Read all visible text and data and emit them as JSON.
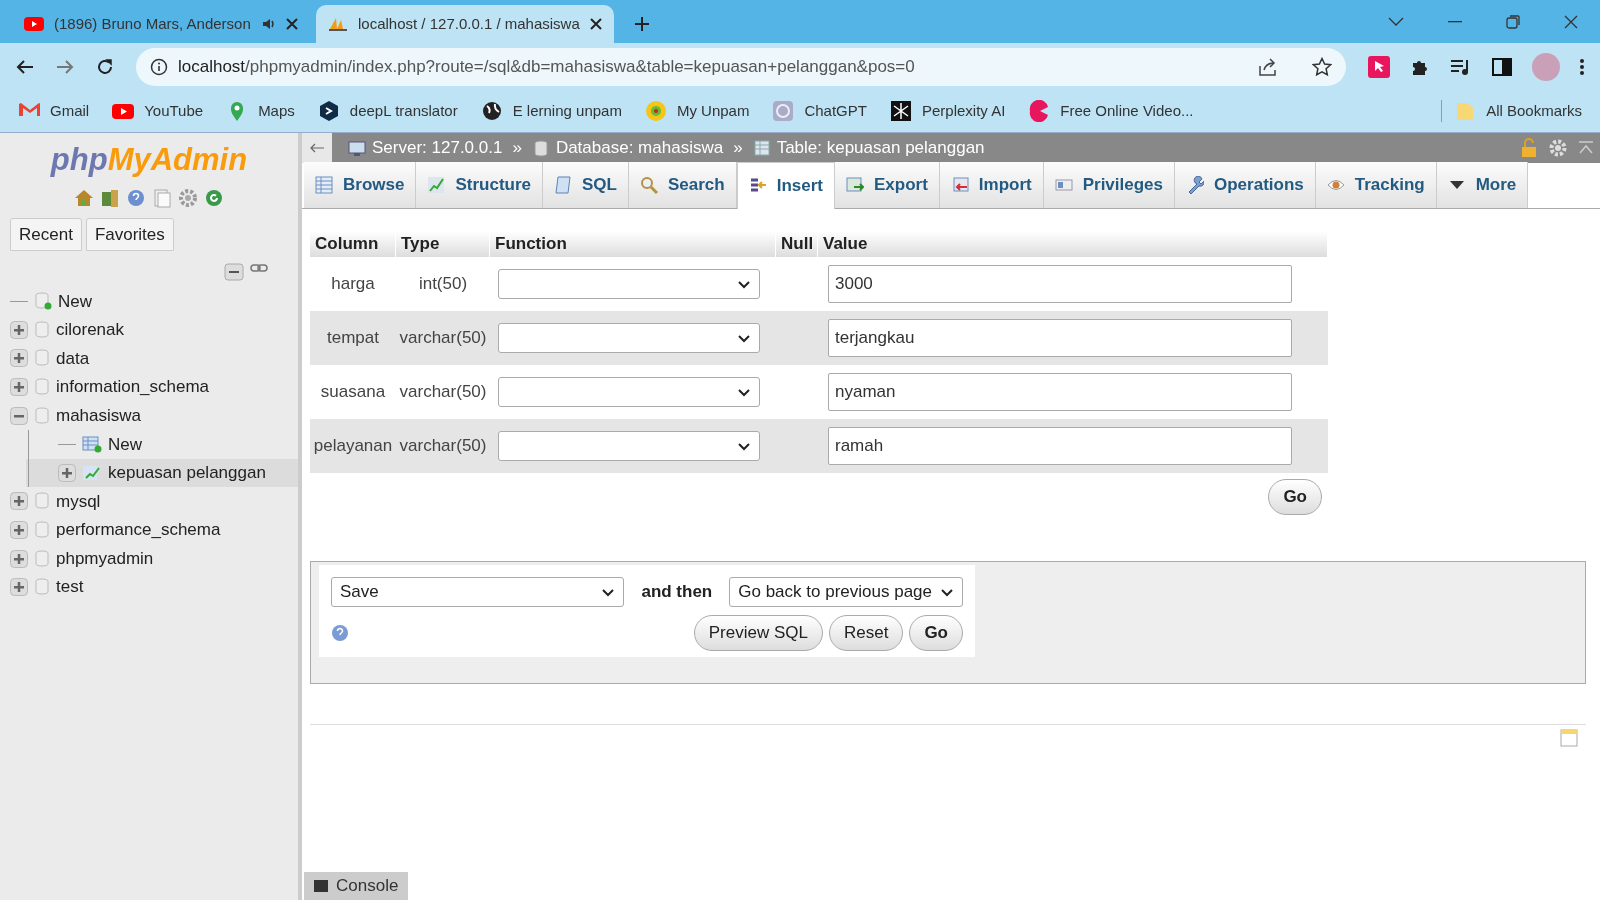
{
  "browser": {
    "tabs": [
      {
        "kind": "video",
        "title": "(1896) Bruno Mars, Anderson",
        "audio": true,
        "selected": false
      },
      {
        "kind": "pma",
        "title": "localhost / 127.0.0.1 / mahasiswa",
        "audio": false,
        "selected": true
      }
    ],
    "address": {
      "host": "localhost",
      "path": "/phpmyadmin/index.php?route=/sql&db=mahasiswa&table=kepuasan+pelanggan&pos=0"
    },
    "bookmarks": [
      {
        "label": "Gmail"
      },
      {
        "label": "YouTube"
      },
      {
        "label": "Maps"
      },
      {
        "label": "deepL translator"
      },
      {
        "label": "E lerning unpam"
      },
      {
        "label": "My Unpam"
      },
      {
        "label": "ChatGPT"
      },
      {
        "label": "Perplexity AI"
      },
      {
        "label": "Free Online Video..."
      }
    ],
    "all_bookmarks": "All Bookmarks"
  },
  "sidebar": {
    "logo_php": "php",
    "logo_rest": "MyAdmin",
    "tabs": [
      "Recent",
      "Favorites"
    ],
    "tree": [
      {
        "kind": "new",
        "label": "New"
      },
      {
        "kind": "db",
        "label": "cilorenak",
        "expanded": false,
        "selected": false
      },
      {
        "kind": "db",
        "label": "data",
        "expanded": false,
        "selected": false
      },
      {
        "kind": "db",
        "label": "information_schema",
        "expanded": false,
        "selected": false
      },
      {
        "kind": "db",
        "label": "mahasiswa",
        "expanded": true,
        "selected": false,
        "children": [
          {
            "kind": "new",
            "label": "New"
          },
          {
            "kind": "table",
            "label": "kepuasan pelanggan",
            "expanded": false,
            "selected": true
          }
        ]
      },
      {
        "kind": "db",
        "label": "mysql",
        "expanded": false,
        "selected": false
      },
      {
        "kind": "db",
        "label": "performance_schema",
        "expanded": false,
        "selected": false
      },
      {
        "kind": "db",
        "label": "phpmyadmin",
        "expanded": false,
        "selected": false
      },
      {
        "kind": "db",
        "label": "test",
        "expanded": false,
        "selected": false
      }
    ]
  },
  "breadcrumb_separator": "»",
  "breadcrumb": [
    {
      "label": "Server: 127.0.0.1"
    },
    {
      "label": "Database: mahasiswa"
    },
    {
      "label": "Table: kepuasan pelanggan"
    }
  ],
  "nav_tabs": [
    {
      "label": "Browse",
      "selected": false
    },
    {
      "label": "Structure",
      "selected": false
    },
    {
      "label": "SQL",
      "selected": false
    },
    {
      "label": "Search",
      "selected": false
    },
    {
      "label": "Insert",
      "selected": true
    },
    {
      "label": "Export",
      "selected": false
    },
    {
      "label": "Import",
      "selected": false
    },
    {
      "label": "Privileges",
      "selected": false
    },
    {
      "label": "Operations",
      "selected": false
    },
    {
      "label": "Tracking",
      "selected": false
    },
    {
      "label": "More",
      "selected": false
    }
  ],
  "insert_table": {
    "columns": [
      "Column",
      "Type",
      "Function",
      "Null",
      "Value"
    ],
    "rows": [
      {
        "column": "harga",
        "type": "int(50)",
        "value": "3000"
      },
      {
        "column": "tempat",
        "type": "varchar(50)",
        "value": "terjangkau"
      },
      {
        "column": "suasana",
        "type": "varchar(50)",
        "value": "nyaman"
      },
      {
        "column": "pelayanan",
        "type": "varchar(50)",
        "value": "ramah"
      }
    ],
    "go_button": "Go"
  },
  "actions": {
    "mode": "Save",
    "and_then": "and then",
    "after": "Go back to previous page",
    "buttons": [
      "Preview SQL",
      "Reset",
      "Go"
    ]
  },
  "console": "Console"
}
